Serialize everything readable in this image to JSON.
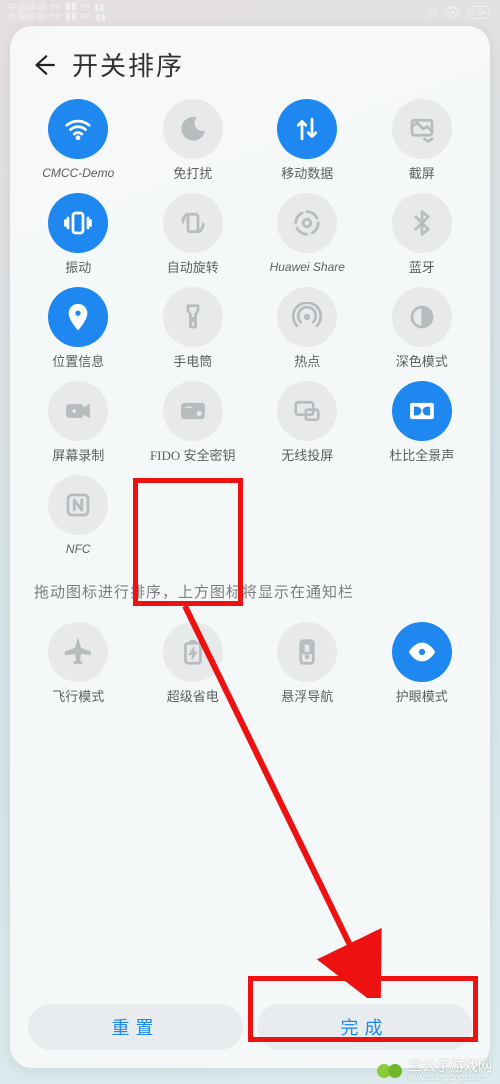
{
  "status": {
    "carrier": "中国移动",
    "hd_badge": "HD",
    "signal_badges": [
      "46",
      "4G"
    ]
  },
  "header": {
    "title": "开关排序"
  },
  "toggles": [
    {
      "id": "wifi",
      "label": "CMCC-Demo",
      "label_style": "eng",
      "active": true,
      "icon": "wifi"
    },
    {
      "id": "dnd",
      "label": "免打扰",
      "active": false,
      "icon": "moon"
    },
    {
      "id": "mobile-data",
      "label": "移动数据",
      "active": true,
      "icon": "data"
    },
    {
      "id": "screenshot",
      "label": "截屏",
      "active": false,
      "icon": "screenshot"
    },
    {
      "id": "vibrate",
      "label": "振动",
      "active": true,
      "icon": "vibrate"
    },
    {
      "id": "auto-rotate",
      "label": "自动旋转",
      "active": false,
      "icon": "rotate"
    },
    {
      "id": "huawei-share",
      "label": "Huawei Share",
      "label_style": "eng",
      "active": false,
      "icon": "share"
    },
    {
      "id": "bluetooth",
      "label": "蓝牙",
      "active": false,
      "icon": "bt"
    },
    {
      "id": "location",
      "label": "位置信息",
      "active": true,
      "icon": "location"
    },
    {
      "id": "flashlight",
      "label": "手电筒",
      "active": false,
      "icon": "flashlight"
    },
    {
      "id": "hotspot",
      "label": "热点",
      "active": false,
      "icon": "hotspot"
    },
    {
      "id": "dark-mode",
      "label": "深色模式",
      "active": false,
      "icon": "darkmode"
    },
    {
      "id": "screen-rec",
      "label": "屏幕录制",
      "active": false,
      "icon": "record"
    },
    {
      "id": "fido",
      "label": "FIDO 安全密钥",
      "active": false,
      "icon": "fido"
    },
    {
      "id": "wireless-prj",
      "label": "无线投屏",
      "active": false,
      "icon": "cast"
    },
    {
      "id": "dolby",
      "label": "杜比全景声",
      "active": true,
      "icon": "dolby"
    },
    {
      "id": "nfc",
      "label": "NFC",
      "label_style": "eng",
      "active": false,
      "icon": "nfc"
    }
  ],
  "hint_text": "拖动图标进行排序，上方图标将显示在通知栏",
  "extra_toggles": [
    {
      "id": "airplane",
      "label": "飞行模式",
      "active": false,
      "icon": "airplane"
    },
    {
      "id": "power-save",
      "label": "超级省电",
      "active": false,
      "icon": "powersave"
    },
    {
      "id": "floating-nav",
      "label": "悬浮导航",
      "active": false,
      "icon": "floatnav"
    },
    {
      "id": "eye-comfort",
      "label": "护眼模式",
      "active": true,
      "icon": "eye"
    }
  ],
  "buttons": {
    "reset": "重置",
    "done": "完成"
  },
  "watermark": {
    "text": "三公子游戏网",
    "url": "www.sangongzi.net"
  },
  "annotation": {
    "highlight_tile": "fido",
    "arrow_target": "done"
  }
}
